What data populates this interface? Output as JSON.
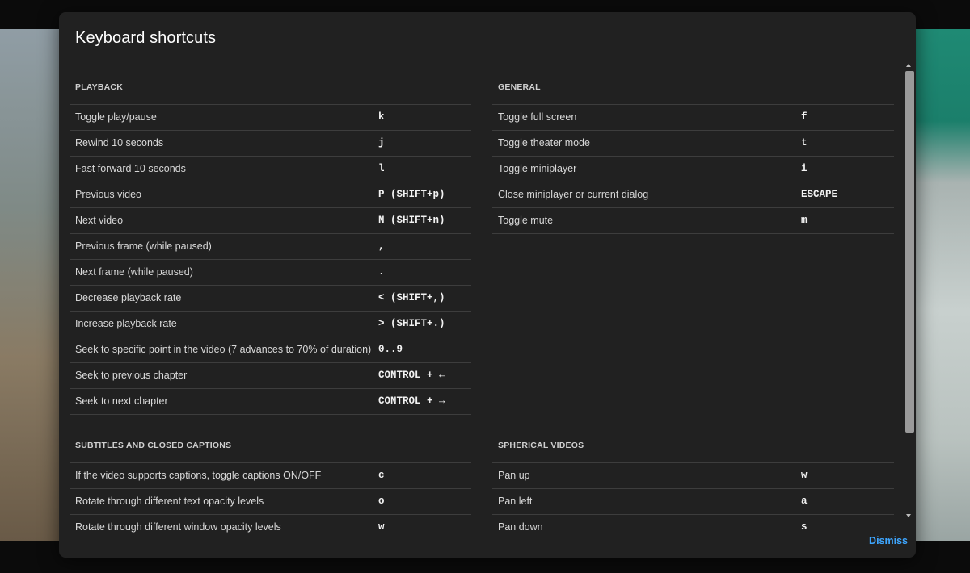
{
  "dialog": {
    "title": "Keyboard shortcuts",
    "dismiss_label": "Dismiss"
  },
  "sections": {
    "playback": {
      "heading": "PLAYBACK",
      "rows": [
        {
          "desc": "Toggle play/pause",
          "key": "k"
        },
        {
          "desc": "Rewind 10 seconds",
          "key": "j"
        },
        {
          "desc": "Fast forward 10 seconds",
          "key": "l"
        },
        {
          "desc": "Previous video",
          "key": "P (SHIFT+p)"
        },
        {
          "desc": "Next video",
          "key": "N (SHIFT+n)"
        },
        {
          "desc": "Previous frame (while paused)",
          "key": ","
        },
        {
          "desc": "Next frame (while paused)",
          "key": "."
        },
        {
          "desc": "Decrease playback rate",
          "key": "< (SHIFT+,)"
        },
        {
          "desc": "Increase playback rate",
          "key": "> (SHIFT+.)"
        },
        {
          "desc": "Seek to specific point in the video (7 advances to 70% of duration)",
          "key": "0..9"
        },
        {
          "desc": "Seek to previous chapter",
          "key": "CONTROL + ←"
        },
        {
          "desc": "Seek to next chapter",
          "key": "CONTROL + →"
        }
      ]
    },
    "general": {
      "heading": "GENERAL",
      "rows": [
        {
          "desc": "Toggle full screen",
          "key": "f"
        },
        {
          "desc": "Toggle theater mode",
          "key": "t"
        },
        {
          "desc": "Toggle miniplayer",
          "key": "i"
        },
        {
          "desc": "Close miniplayer or current dialog",
          "key": "ESCAPE"
        },
        {
          "desc": "Toggle mute",
          "key": "m"
        }
      ]
    },
    "subtitles": {
      "heading": "SUBTITLES AND CLOSED CAPTIONS",
      "rows": [
        {
          "desc": "If the video supports captions, toggle captions ON/OFF",
          "key": "c"
        },
        {
          "desc": "Rotate through different text opacity levels",
          "key": "o"
        },
        {
          "desc": "Rotate through different window opacity levels",
          "key": "w"
        }
      ]
    },
    "spherical": {
      "heading": "SPHERICAL VIDEOS",
      "rows": [
        {
          "desc": "Pan up",
          "key": "w"
        },
        {
          "desc": "Pan left",
          "key": "a"
        },
        {
          "desc": "Pan down",
          "key": "s"
        }
      ]
    }
  },
  "icons": {
    "scroll_up": "scroll-up-arrow-icon",
    "scroll_down": "scroll-down-arrow-icon"
  },
  "colors": {
    "dialog_bg": "#212121",
    "link": "#3ea6ff",
    "divider": "#3d3d3d"
  }
}
